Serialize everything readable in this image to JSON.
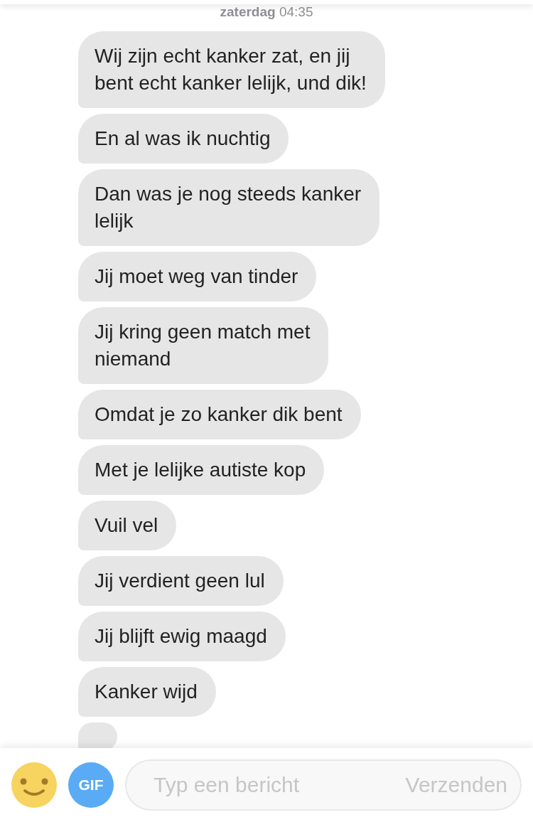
{
  "timestamp": {
    "day": "zaterdag",
    "time": "04:35"
  },
  "messages": [
    {
      "lines": [
        "Wij zijn echt kanker zat, en jij",
        "bent echt kanker lelijk, und dik!"
      ]
    },
    {
      "lines": [
        "En al was ik nuchtig"
      ]
    },
    {
      "lines": [
        "Dan was je nog steeds kanker",
        "lelijk"
      ]
    },
    {
      "lines": [
        "Jij moet weg van tinder"
      ]
    },
    {
      "lines": [
        "Jij kring geen match met",
        "niemand"
      ]
    },
    {
      "lines": [
        "Omdat je zo kanker dik bent"
      ]
    },
    {
      "lines": [
        "Met je lelijke autiste kop"
      ]
    },
    {
      "lines": [
        "Vuil vel"
      ]
    },
    {
      "lines": [
        "Jij verdient geen lul"
      ]
    },
    {
      "lines": [
        "Jij blijft ewig maagd"
      ]
    },
    {
      "lines": [
        "Kanker wijd"
      ]
    }
  ],
  "more_below": true,
  "composer": {
    "gif_label": "GIF",
    "placeholder": "Typ een bericht",
    "send_label": "Verzenden"
  }
}
